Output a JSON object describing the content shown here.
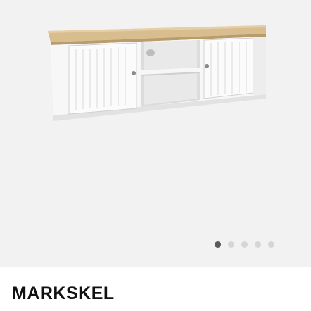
{
  "product": {
    "title": "MARKSKEL",
    "image_icon": "tv-bench-image"
  },
  "gallery": {
    "total_images": 5,
    "active_index": 0
  },
  "colors": {
    "background": "#f2f2f2",
    "dot_active": "#5a5a5a",
    "dot_inactive": "#d6d6d6",
    "title": "#111111"
  }
}
